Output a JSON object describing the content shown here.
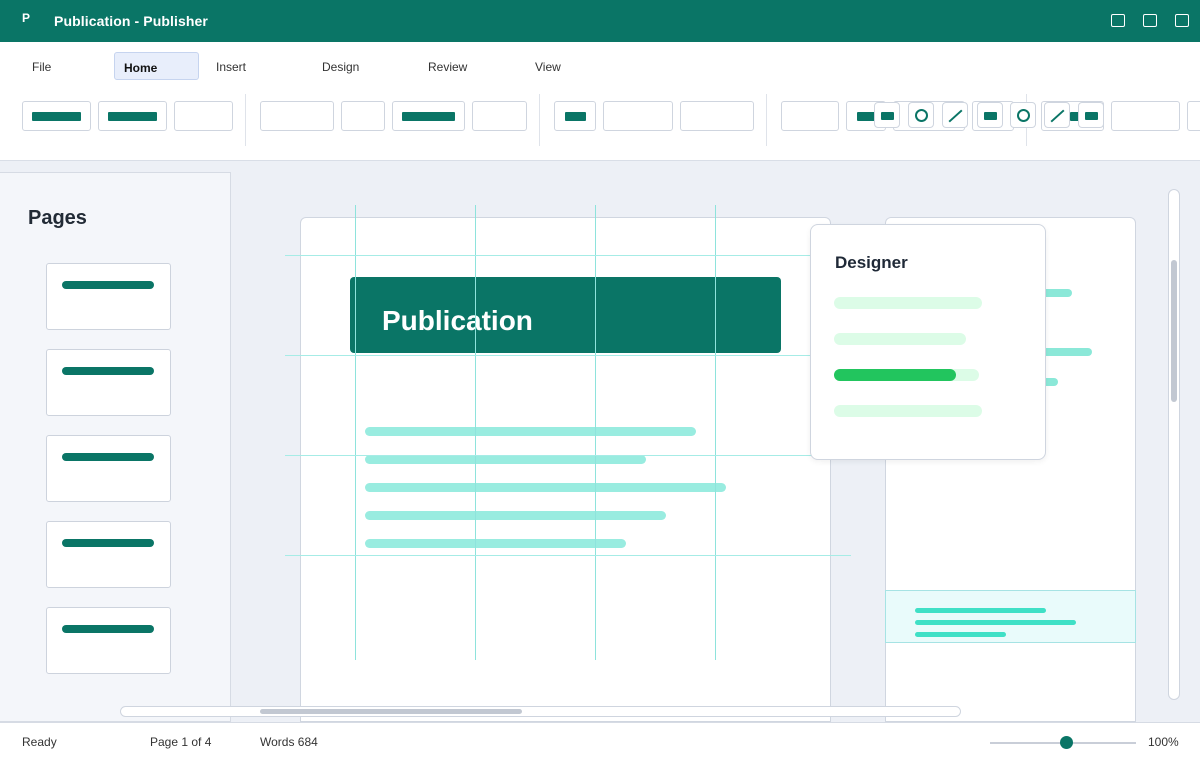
{
  "window": {
    "app_icon": "P",
    "title": "Publication - Publisher",
    "controls": [
      "minimize-icon",
      "maximize-icon",
      "close-icon"
    ]
  },
  "ribbon": {
    "tabs": [
      {
        "label": "File",
        "active": false
      },
      {
        "label": "Home",
        "active": true
      },
      {
        "label": "Insert",
        "active": false
      },
      {
        "label": "Design",
        "active": false
      },
      {
        "label": "Review",
        "active": false
      },
      {
        "label": "View",
        "active": false
      }
    ],
    "tools": [
      "rectangle-icon",
      "circle-icon",
      "line-icon",
      "rectangle-icon",
      "circle-icon",
      "line-icon",
      "rectangle-icon"
    ]
  },
  "pages_panel": {
    "title": "Pages",
    "page_count": 5
  },
  "canvas": {
    "header_text": "Publication"
  },
  "designer": {
    "title": "Designer",
    "option_count": 4,
    "selected_option": 3
  },
  "statusbar": {
    "ready": "Ready",
    "page": "Page 1 of 4",
    "words": "Words 684",
    "zoom": "100%"
  },
  "colors": {
    "brand": "#0a7566",
    "accent_green": "#22c55e",
    "text_line": "#99ece0"
  }
}
